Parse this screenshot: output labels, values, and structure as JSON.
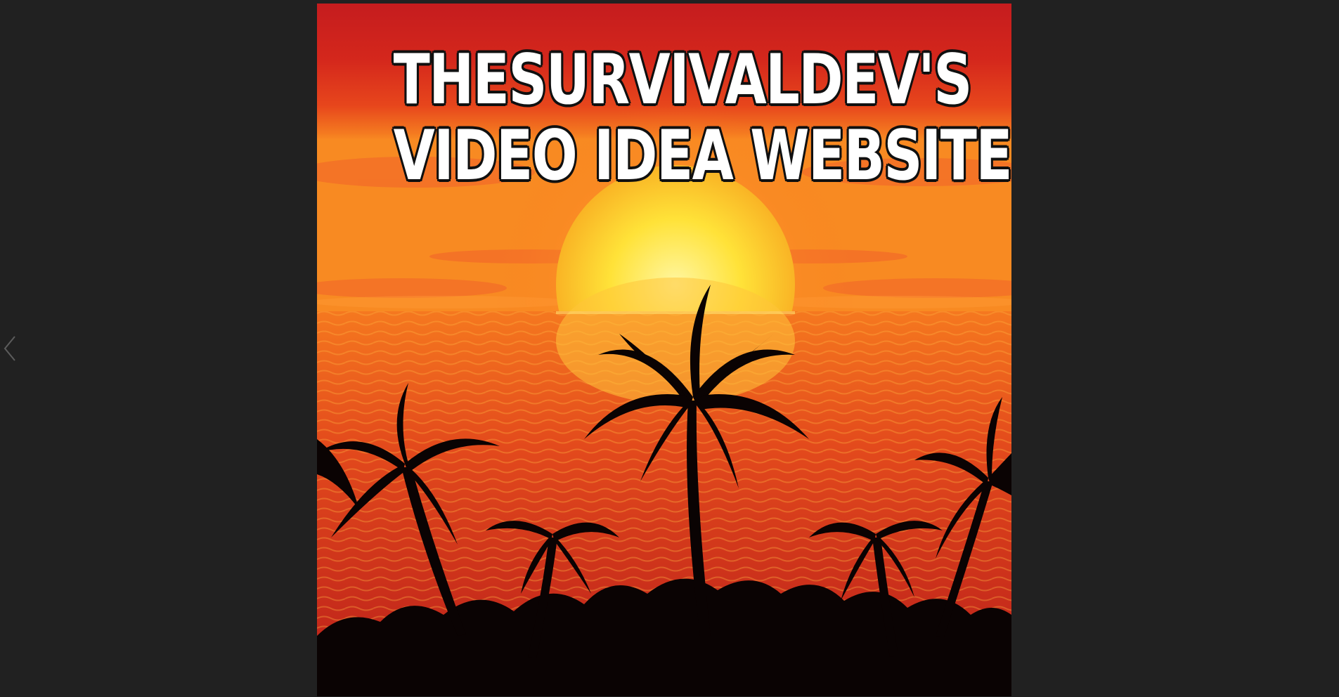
{
  "viewer": {
    "background": "#212121",
    "prev_icon": "chevron-left-icon"
  },
  "image": {
    "title_lines": [
      "THESURVIVALDEV'S",
      "VIDEO IDEA WEBSITE"
    ],
    "scene": "sunset-over-ocean-with-palm-tree-silhouettes",
    "colors": {
      "sky_top": "#c8201c",
      "sky_mid": "#e8471c",
      "sun": "#ffe43a",
      "sea": "#d83a1e",
      "silhouette": "#0a0303"
    }
  }
}
